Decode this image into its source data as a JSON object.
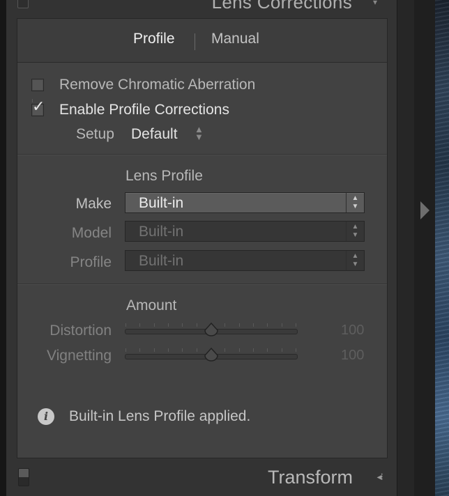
{
  "panel": {
    "title": "Lens Corrections",
    "tabs": [
      {
        "label": "Profile",
        "active": true
      },
      {
        "label": "Manual",
        "active": false
      }
    ],
    "options": {
      "remove_chromatic_aberration": {
        "label": "Remove Chromatic Aberration",
        "checked": false
      },
      "enable_profile_corrections": {
        "label": "Enable Profile Corrections",
        "checked": true
      }
    },
    "setup": {
      "label": "Setup",
      "value": "Default"
    },
    "lens_profile": {
      "title": "Lens Profile",
      "fields": [
        {
          "label": "Make",
          "value": "Built-in",
          "enabled": true
        },
        {
          "label": "Model",
          "value": "Built-in",
          "enabled": false
        },
        {
          "label": "Profile",
          "value": "Built-in",
          "enabled": false
        }
      ]
    },
    "amount": {
      "title": "Amount",
      "sliders": [
        {
          "label": "Distortion",
          "value": "100",
          "fraction": 0.5
        },
        {
          "label": "Vignetting",
          "value": "100",
          "fraction": 0.5
        }
      ]
    },
    "info": {
      "text": "Built-in Lens Profile applied.",
      "icon": "info-icon"
    }
  },
  "next_panel": {
    "title": "Transform"
  },
  "colors": {
    "panel_bg": "#424242",
    "frame_bg": "#333333",
    "text_active": "#e4e4e4",
    "text_dim": "#818181"
  }
}
